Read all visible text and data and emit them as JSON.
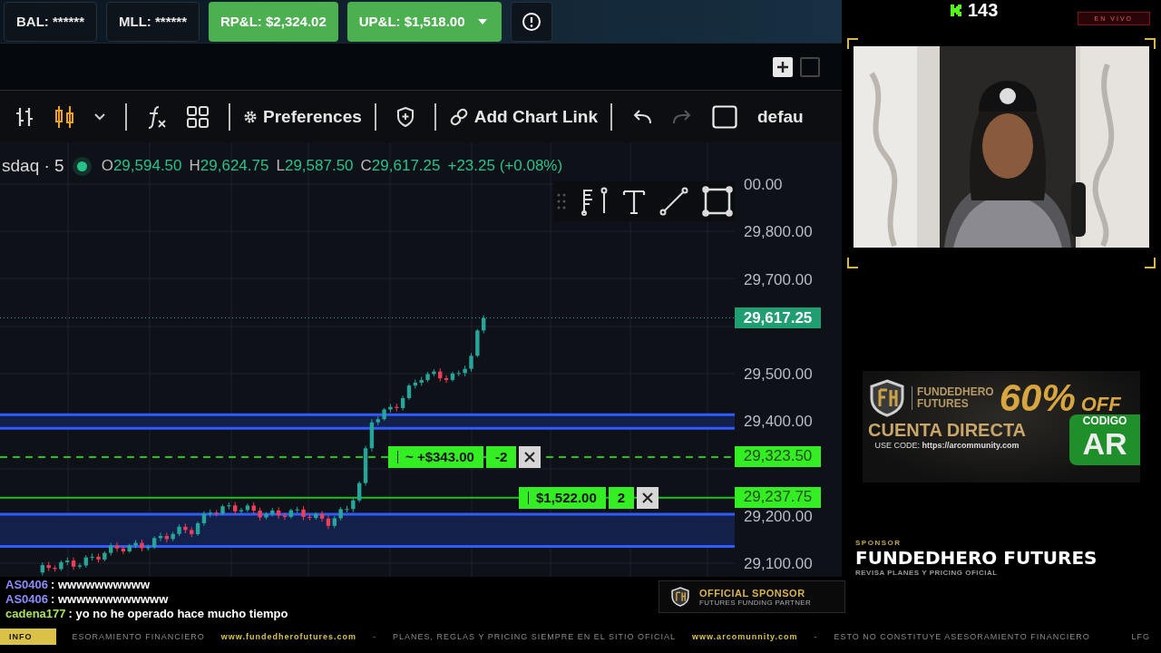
{
  "account_bar": {
    "items": [
      {
        "kind": "plain",
        "label": "BAL: ******"
      },
      {
        "kind": "plain",
        "label": "MLL: ******"
      },
      {
        "kind": "profit",
        "label": "RP&L: $2,324.02"
      },
      {
        "kind": "profit_menu",
        "label": "UP&L: $1,518.00"
      },
      {
        "kind": "alert"
      }
    ]
  },
  "toolbar": {
    "left": [
      {
        "kind": "bars"
      },
      {
        "kind": "candles"
      },
      {
        "kind": "caret"
      },
      {
        "kind": "divider"
      },
      {
        "kind": "fx"
      },
      {
        "kind": "grid"
      },
      {
        "kind": "divider"
      },
      {
        "kind": "settings",
        "label": "Preferences"
      },
      {
        "kind": "divider"
      },
      {
        "kind": "shield"
      },
      {
        "kind": "divider"
      },
      {
        "kind": "link",
        "label": "Add Chart Link"
      },
      {
        "kind": "divider"
      }
    ],
    "history": [
      {
        "kind": "undo",
        "disabled": false
      },
      {
        "kind": "redo",
        "disabled": true
      }
    ],
    "right": [
      {
        "kind": "square"
      },
      {
        "kind": "text",
        "label": "defau"
      }
    ]
  },
  "legend": {
    "symbol": "sdaq · 5",
    "values": [
      {
        "key": "O",
        "value": "29,594.50"
      },
      {
        "key": "H",
        "value": "29,624.75"
      },
      {
        "key": "L",
        "value": "29,587.50"
      },
      {
        "key": "C",
        "value": "29,617.25"
      }
    ],
    "change": "+23.25 (+0.08%)"
  },
  "price_axis": {
    "labels": [
      "00.00",
      "29,800.00",
      "29,700.00",
      "29,500.00",
      "29,400.00",
      "29,200.00",
      "29,100.00"
    ],
    "last_price": "29,617.25"
  },
  "orders": [
    {
      "pnl": "~ +$343.00",
      "qty": "-2",
      "price": "29,323.50",
      "kind": "dashed"
    },
    {
      "pnl": "$1,522.00",
      "qty": "2",
      "price": "29,237.75",
      "kind": "solid"
    }
  ],
  "chat": {
    "messages": [
      {
        "user": "AS0406",
        "text": ": wwwwwwwwww",
        "color": "#8c8cff"
      },
      {
        "user": "AS0406",
        "text": ": wwwwwwwwwwww",
        "color": "#8c8cff"
      },
      {
        "user": "cadena177",
        "text": ": yo no he operado hace mucho tiempo",
        "color": "#a8e05a"
      }
    ]
  },
  "sponsor_badge": {
    "title": "OFFICIAL SPONSOR",
    "subtitle": "FUTURES FUNDING PARTNER"
  },
  "ticker": [
    {
      "kind": "label",
      "text": "INFO"
    },
    {
      "kind": "text",
      "text": "ESORAMIENTO FINANCIERO"
    },
    {
      "kind": "link",
      "text": "www.fundedherofutures.com"
    },
    {
      "kind": "sep",
      "text": "-"
    },
    {
      "kind": "text",
      "text": "PLANES, REGLAS Y PRICING SIEMPRE EN EL SITIO OFICIAL"
    },
    {
      "kind": "link",
      "text": "www.arcomunnity.com"
    },
    {
      "kind": "sep",
      "text": "-"
    },
    {
      "kind": "text",
      "text": "ESTO NO CONSTITUYE ASESORAMIENTO FINANCIERO"
    },
    {
      "kind": "end",
      "text": "LFG"
    }
  ],
  "stream": {
    "viewers": "143",
    "live_badge": "EN VIVO"
  },
  "ad_banner": {
    "brand_line_1": "FUNDEDHERO",
    "brand_line_2": "FUTURES",
    "discount": "60%",
    "discount_suffix": "OFF",
    "headline": "CUENTA DIRECTA",
    "code_prefix": "USE CODE:",
    "code_url": "https://arcommunity.com",
    "code_label": "CODIGO",
    "code": "AR"
  },
  "sponsor": {
    "eyebrow": "SPONSOR",
    "name": "FUNDEDHERO FUTURES",
    "tagline": "REVISA PLANES Y PRICING OFICIAL"
  }
}
